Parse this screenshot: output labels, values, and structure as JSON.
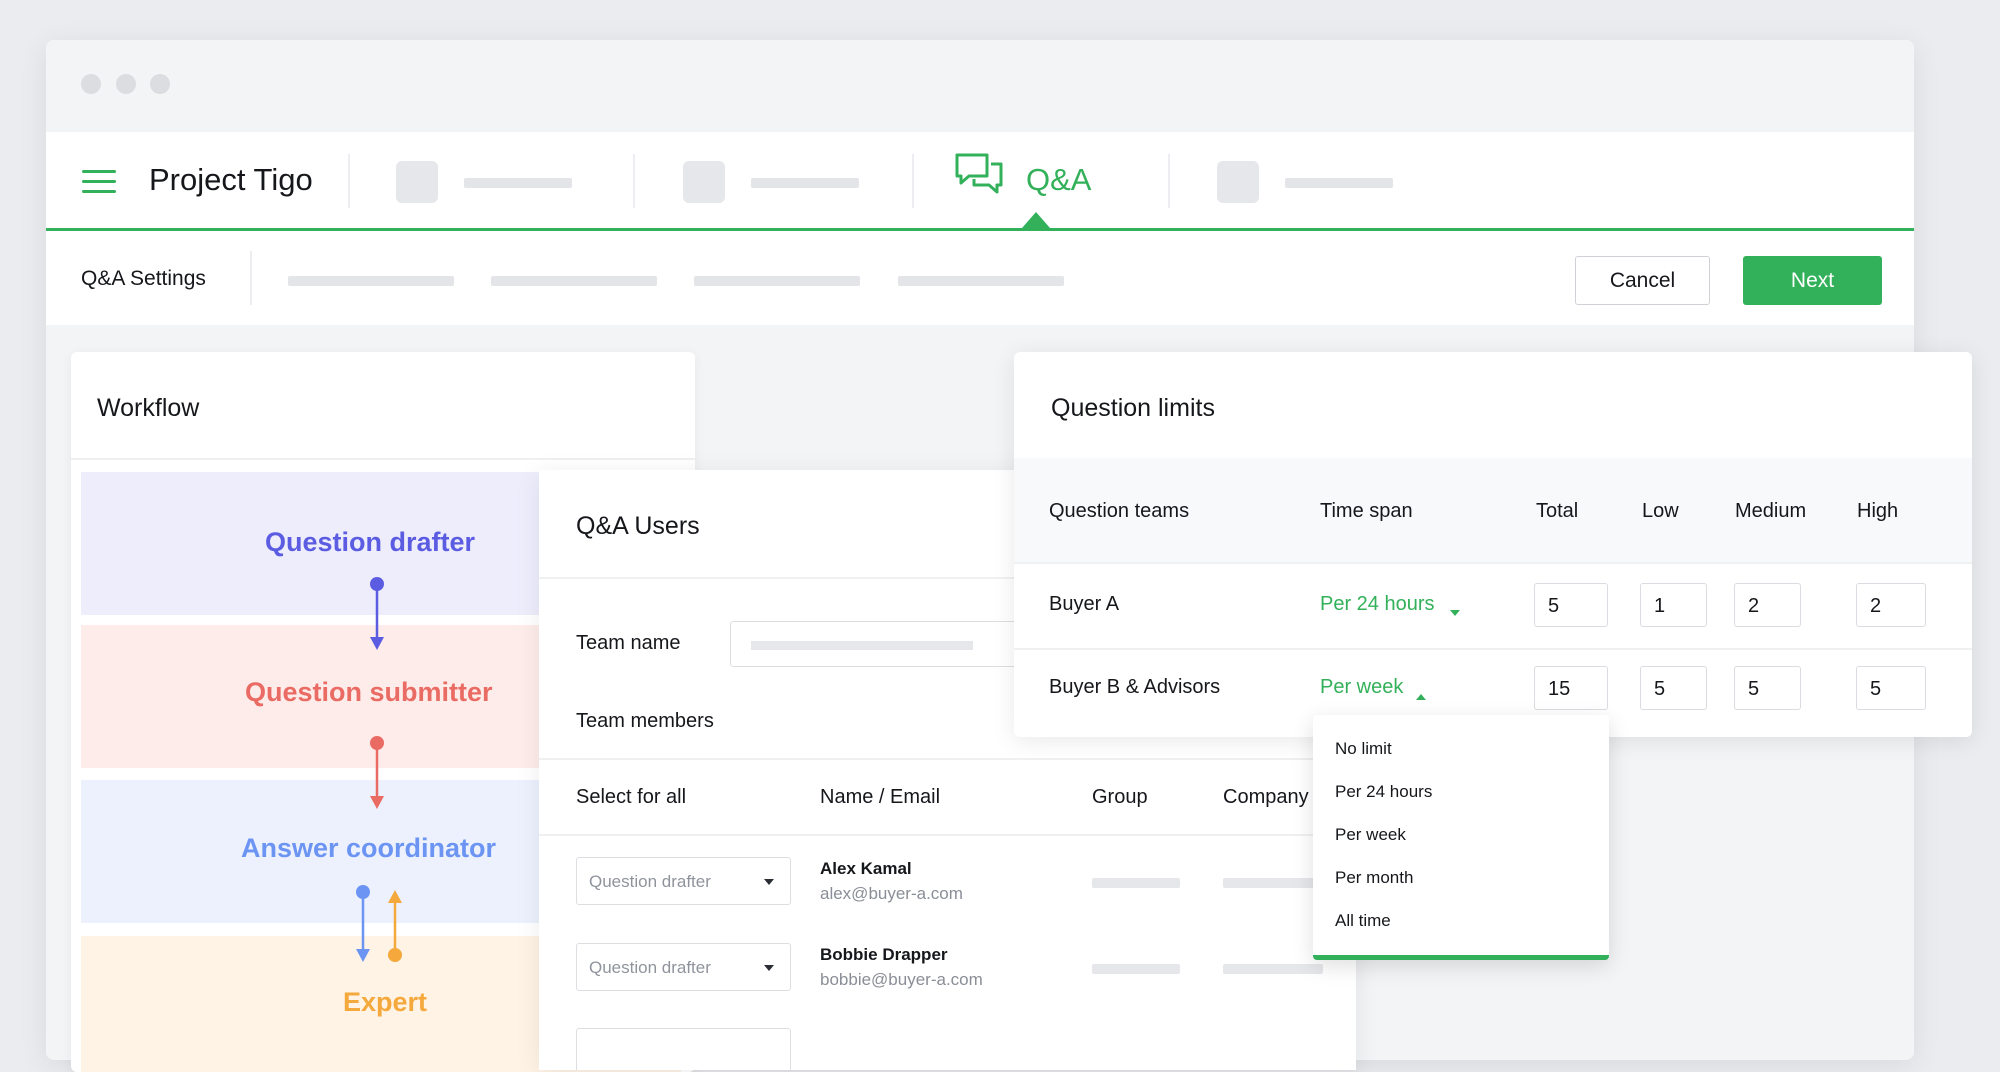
{
  "app": {
    "project_title": "Project Tigo",
    "active_tab": "Q&A"
  },
  "subbar": {
    "title": "Q&A Settings",
    "cancel_label": "Cancel",
    "next_label": "Next"
  },
  "workflow": {
    "title": "Workflow",
    "roles": [
      {
        "label": "Question drafter",
        "color": "#5b5ce2",
        "band": "#ededfc"
      },
      {
        "label": "Question submitter",
        "color": "#ea6b63",
        "band": "#fdecea"
      },
      {
        "label": "Answer coordinator",
        "color": "#6b94f3",
        "band": "#edf1fd"
      },
      {
        "label": "Expert",
        "color": "#f5a83c",
        "band": "#fef3e5"
      }
    ]
  },
  "users": {
    "title": "Q&A Users",
    "team_name_label": "Team name",
    "team_members_label": "Team members",
    "columns": [
      "Select for all",
      "Name / Email",
      "Group",
      "Company"
    ],
    "rows": [
      {
        "role": "Question drafter",
        "name": "Alex Kamal",
        "email": "alex@buyer-a.com"
      },
      {
        "role": "Question drafter",
        "name": "Bobbie Drapper",
        "email": "bobbie@buyer-a.com"
      }
    ]
  },
  "limits": {
    "title": "Question limits",
    "columns": [
      "Question teams",
      "Time span",
      "Total",
      "Low",
      "Medium",
      "High"
    ],
    "rows": [
      {
        "team": "Buyer A",
        "span": "Per 24 hours",
        "total": "5",
        "low": "1",
        "medium": "2",
        "high": "2"
      },
      {
        "team": "Buyer B & Advisors",
        "span": "Per week",
        "total": "15",
        "low": "5",
        "medium": "5",
        "high": "5"
      }
    ]
  },
  "dropdown": {
    "options": [
      "No limit",
      "Per 24 hours",
      "Per week",
      "Per month",
      "All time"
    ]
  },
  "colors": {
    "accent": "#33b15a"
  }
}
